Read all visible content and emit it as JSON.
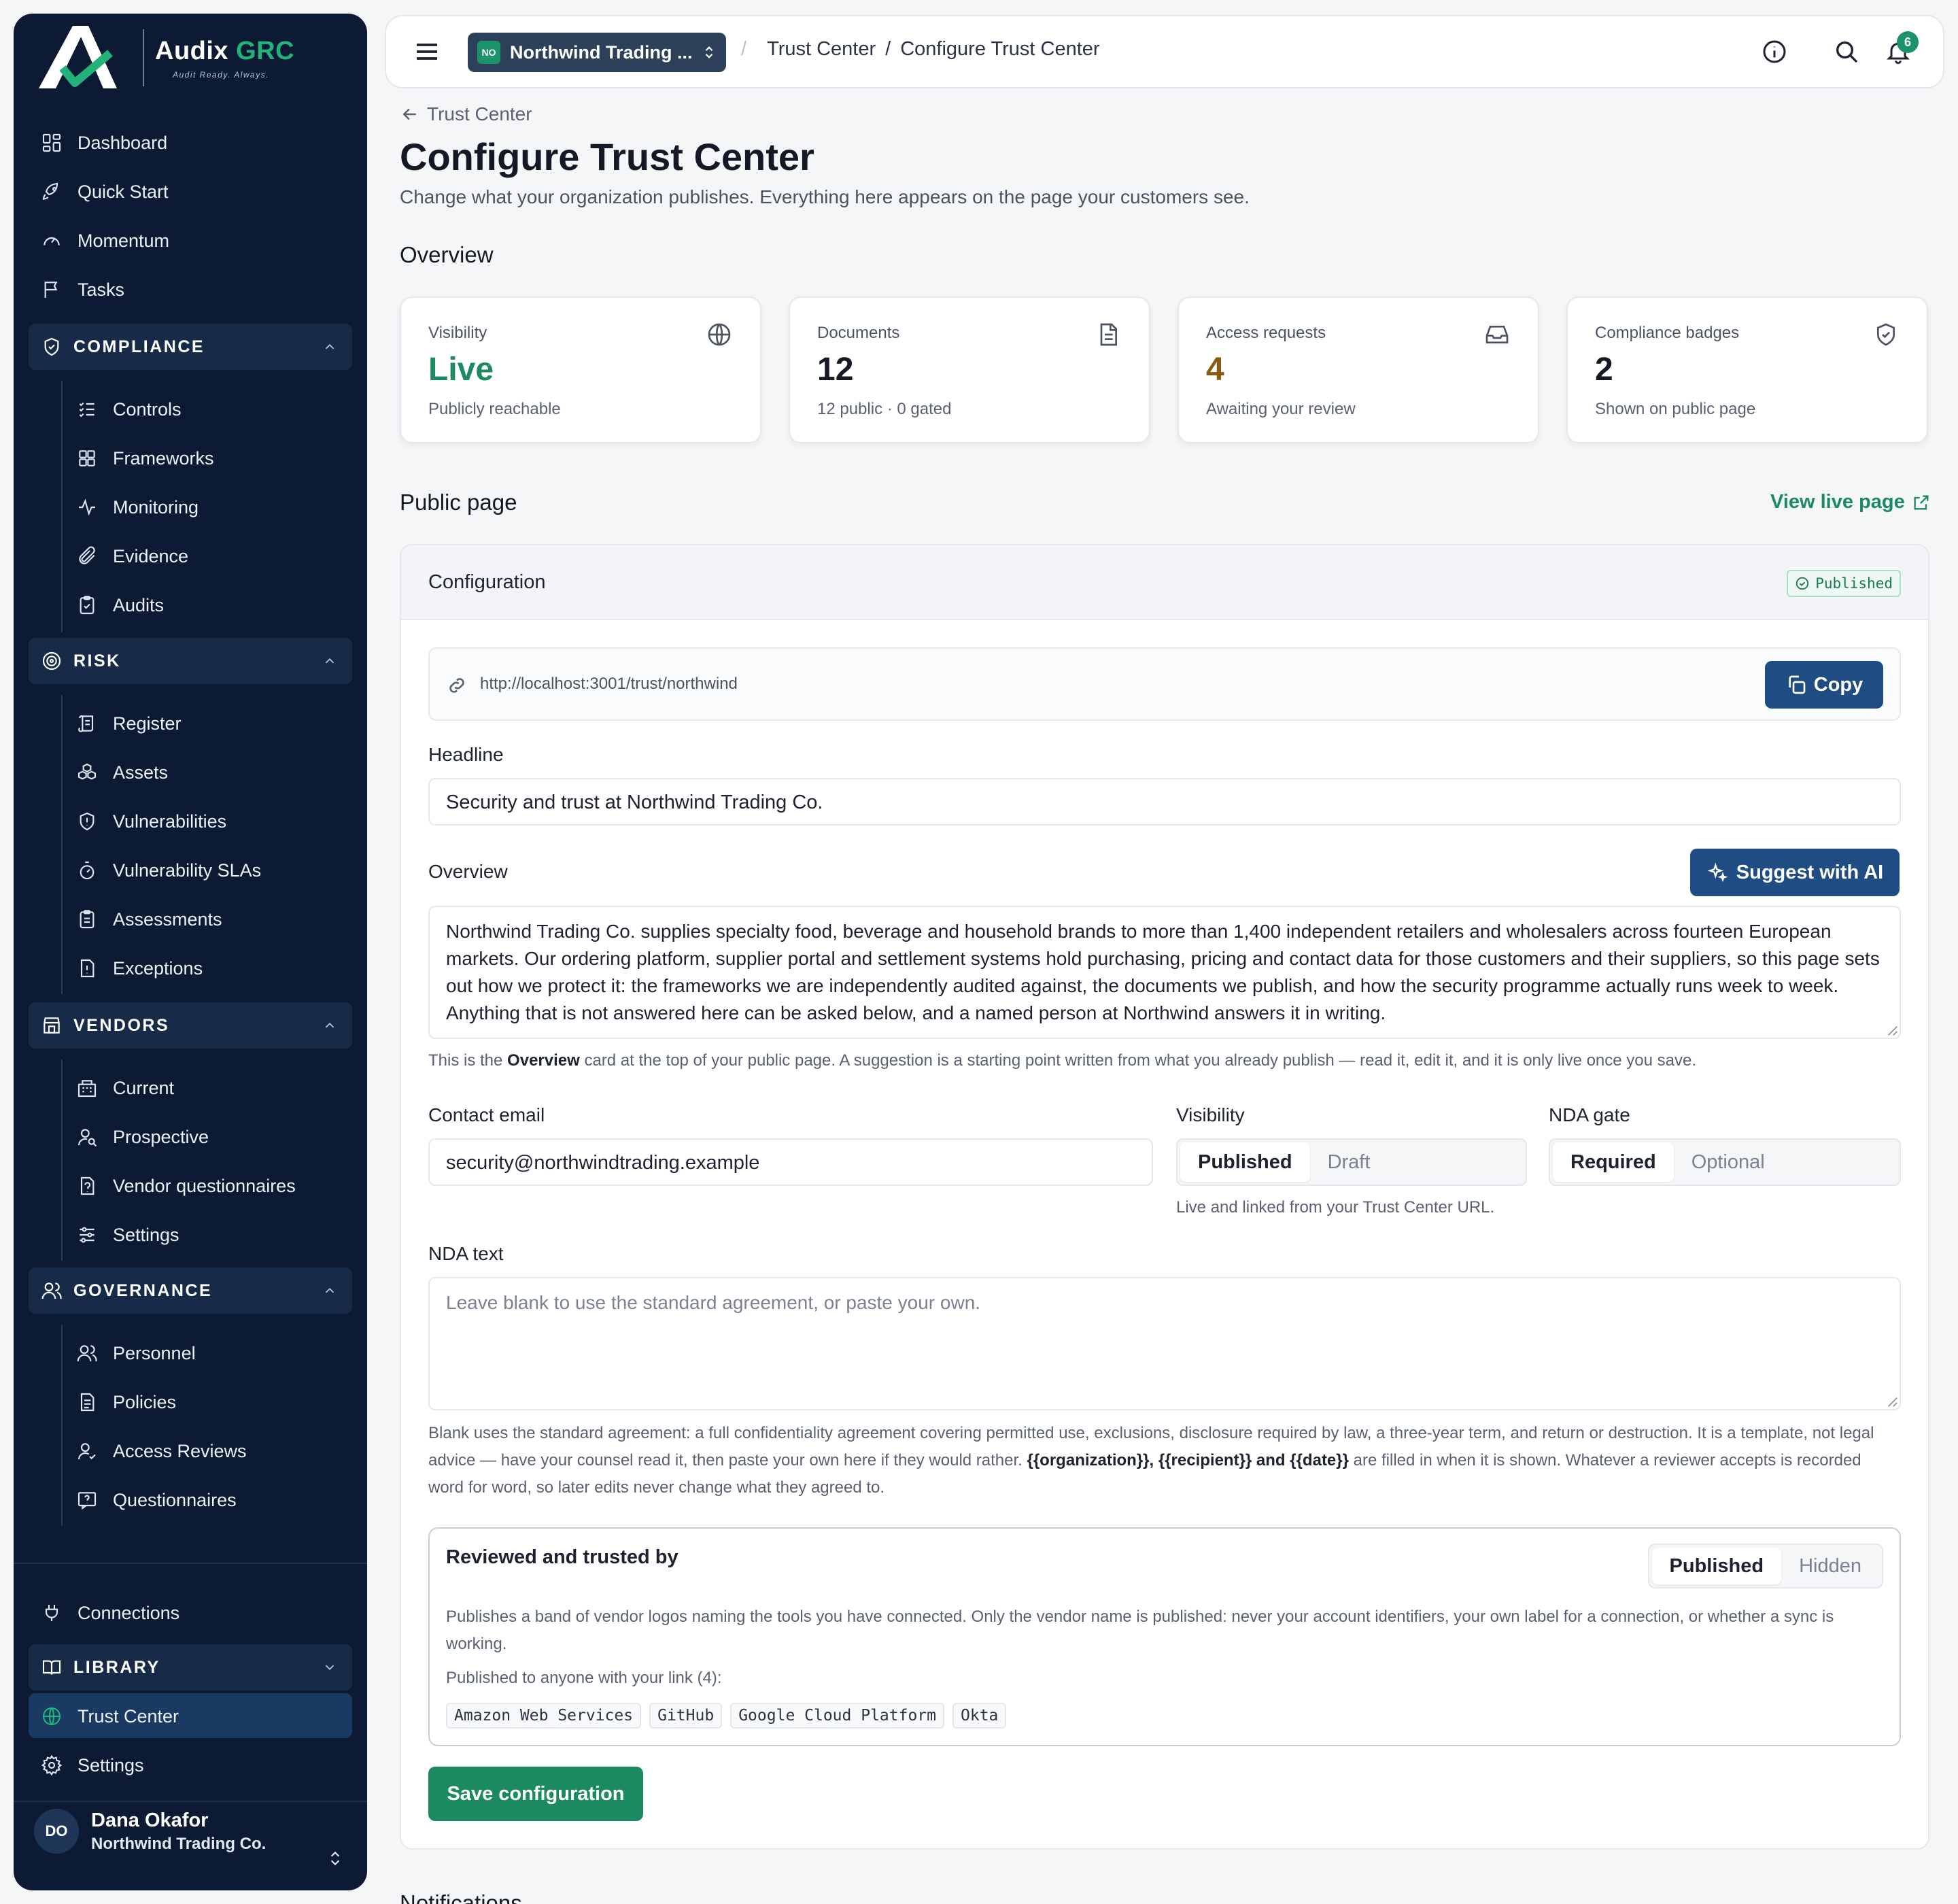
{
  "brand": {
    "name": "Audix",
    "name_accent": "GRC",
    "tagline": "Audit Ready. Always."
  },
  "sidebar": {
    "top_items": [
      {
        "label": "Dashboard",
        "icon": "grid-icon"
      },
      {
        "label": "Quick Start",
        "icon": "rocket-icon"
      },
      {
        "label": "Momentum",
        "icon": "gauge-icon"
      },
      {
        "label": "Tasks",
        "icon": "flag-icon"
      }
    ],
    "compliance": {
      "title": "COMPLIANCE",
      "items": [
        "Controls",
        "Frameworks",
        "Monitoring",
        "Evidence",
        "Audits"
      ]
    },
    "risk": {
      "title": "RISK",
      "items": [
        "Register",
        "Assets",
        "Vulnerabilities",
        "Vulnerability SLAs",
        "Assessments",
        "Exceptions"
      ]
    },
    "vendors": {
      "title": "VENDORS",
      "items": [
        "Current",
        "Prospective",
        "Vendor questionnaires",
        "Settings"
      ]
    },
    "governance": {
      "title": "GOVERNANCE",
      "items": [
        "Personnel",
        "Policies",
        "Access Reviews",
        "Questionnaires"
      ]
    },
    "connections": "Connections",
    "library": {
      "title": "LIBRARY"
    },
    "trust_center": "Trust Center",
    "settings": "Settings",
    "user": {
      "initials": "DO",
      "name": "Dana Okafor",
      "org": "Northwind Trading Co."
    }
  },
  "topbar": {
    "org_badge": "NO",
    "org_name": "Northwind Trading ...",
    "breadcrumb": {
      "parent": "Trust Center",
      "current": "Configure Trust Center"
    },
    "notification_count": "6"
  },
  "page": {
    "back_label": "Trust Center",
    "title": "Configure Trust Center",
    "subtitle": "Change what your organization publishes. Everything here appears on the page your customers see.",
    "overview_heading": "Overview",
    "public_heading": "Public page",
    "view_live": "View live page",
    "next_heading": "Notifications"
  },
  "stats": [
    {
      "label": "Visibility",
      "value": "Live",
      "sub": "Publicly reachable",
      "icon": "globe-icon",
      "color": "#1b8a5f"
    },
    {
      "label": "Documents",
      "value": "12",
      "sub": "12 public · 0 gated",
      "icon": "document-icon",
      "color": "#131a26"
    },
    {
      "label": "Access requests",
      "value": "4",
      "sub": "Awaiting your review",
      "icon": "inbox-icon",
      "color": "#8a5a12"
    },
    {
      "label": "Compliance badges",
      "value": "2",
      "sub": "Shown on public page",
      "icon": "shield-check-icon",
      "color": "#131a26"
    }
  ],
  "config": {
    "title": "Configuration",
    "status": "Published",
    "url": "http://localhost:3001/trust/northwind",
    "copy_label": "Copy",
    "headline_label": "Headline",
    "headline_value": "Security and trust at Northwind Trading Co.",
    "overview_label": "Overview",
    "suggest_label": "Suggest with AI",
    "overview_value": "Northwind Trading Co. supplies specialty food, beverage and household brands to more than 1,400 independent retailers and wholesalers across fourteen European markets. Our ordering platform, supplier portal and settlement systems hold purchasing, pricing and contact data for those customers and their suppliers, so this page sets out how we protect it: the frameworks we are independently audited against, the documents we publish, and how the security programme actually runs week to week. Anything that is not answered here can be asked below, and a named person at Northwind answers it in writing.",
    "overview_help_pre": "This is the ",
    "overview_help_bold": "Overview",
    "overview_help_post": " card at the top of your public page. A suggestion is a starting point written from what you already publish — read it, edit it, and it is only live once you save.",
    "contact_label": "Contact email",
    "contact_value": "security@northwindtrading.example",
    "visibility_label": "Visibility",
    "visibility_options": [
      "Published",
      "Draft"
    ],
    "visibility_help": "Live and linked from your Trust Center URL.",
    "nda_gate_label": "NDA gate",
    "nda_gate_options": [
      "Required",
      "Optional"
    ],
    "nda_text_label": "NDA text",
    "nda_placeholder": "Leave blank to use the standard agreement, or paste your own.",
    "nda_help_pre": "Blank uses the standard agreement: a full confidentiality agreement covering permitted use, exclusions, disclosure required by law, a three-year term, and return or destruction. It is a template, not legal advice — have your counsel read it, then paste your own here if they would rather. ",
    "nda_help_bold": "{{organization}}, {{recipient}} and {{date}}",
    "nda_help_post": " are filled in when it is shown. Whatever a reviewer accepts is recorded word for word, so later edits never change what they agreed to.",
    "reviewed_title": "Reviewed and trusted by",
    "reviewed_options": [
      "Published",
      "Hidden"
    ],
    "reviewed_desc": "Publishes a band of vendor logos naming the tools you have connected. Only the vendor name is published: never your account identifiers, your own label for a connection, or whether a sync is working.",
    "reviewed_list_label": "Published to anyone with your link (4):",
    "vendors": [
      "Amazon Web Services",
      "GitHub",
      "Google Cloud Platform",
      "Okta"
    ],
    "save_label": "Save configuration"
  }
}
